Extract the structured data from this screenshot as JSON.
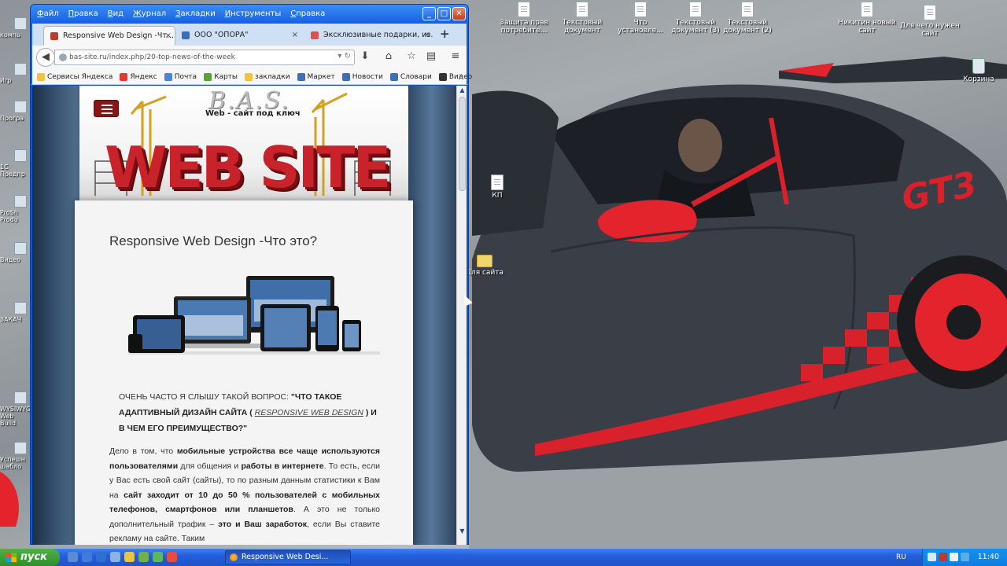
{
  "desktop": {
    "icons": [
      {
        "label": "Защита прав потребите...",
        "kind": "doc"
      },
      {
        "label": "Текстовый документ",
        "kind": "doc"
      },
      {
        "label": "Что установле...",
        "kind": "doc"
      },
      {
        "label": "Текстовый документ (3)",
        "kind": "doc"
      },
      {
        "label": "Текстовый документ (2)",
        "kind": "doc"
      },
      {
        "label": "Никитин новый сайт",
        "kind": "doc"
      },
      {
        "label": "Для чего нужен сайт",
        "kind": "doc"
      },
      {
        "label": "Корзина",
        "kind": "recycle-bin"
      },
      {
        "label": "КП",
        "kind": "doc"
      },
      {
        "label": "Для сайта",
        "kind": "folder"
      }
    ],
    "left_icons": [
      "компь",
      "Иrp",
      "Програ",
      "1С Предпр",
      "ProSh Produ",
      "Видео",
      "ЗАКАЧ",
      "WYSIWYG Web Build",
      "Успешн шабло"
    ]
  },
  "browser": {
    "menu": [
      "Файл",
      "Правка",
      "Вид",
      "Журнал",
      "Закладки",
      "Инструменты",
      "Справка"
    ],
    "window_buttons": {
      "minimize": "_",
      "maximize": "□",
      "close": "✕"
    },
    "tabs": [
      {
        "label": "Responsive Web Design -Чт...",
        "active": true,
        "icon_color": "#c0392b",
        "close": "×"
      },
      {
        "label": "ООО \"ОПОРА\"",
        "active": false,
        "icon_color": "#3a6fb7",
        "close": "×"
      },
      {
        "label": "Эксклюзивные подарки, из...",
        "active": false,
        "icon_color": "#d9534f",
        "close": "×"
      }
    ],
    "new_tab": "+",
    "url": "bas-site.ru/index.php/20-top-news-of-the-week",
    "bookmarks": [
      {
        "label": "Сервисы Яндекса",
        "color": "#f3c23c"
      },
      {
        "label": "Яндекс",
        "color": "#e33b2e"
      },
      {
        "label": "Почта",
        "color": "#4a86d8"
      },
      {
        "label": "Карты",
        "color": "#55a630"
      },
      {
        "label": "закладки",
        "color": "#f3c23c"
      },
      {
        "label": "Маркет",
        "color": "#3d6fb6"
      },
      {
        "label": "Новости",
        "color": "#3d6fb6"
      },
      {
        "label": "Словари",
        "color": "#3d6fb6"
      },
      {
        "label": "Видео",
        "color": "#333333"
      }
    ],
    "bookmarks_more": "»"
  },
  "page": {
    "brand": "B.A.S.",
    "tagline": "Web - сайт   под ключ",
    "big_word": "WEB SITE",
    "article_title": "Responsive Web Design -Что это?",
    "quote_lead": "ОЧЕНЬ ЧАСТО Я СЛЫШУ ТАКОЙ ВОПРОС: ",
    "quote_bold_1": "\"ЧТО ТАКОЕ АДАПТИВНЫЙ ДИЗАЙН САЙТА ( ",
    "quote_link": "RESPONSIVE WEB DESIGN",
    "quote_bold_2": " ) И В ЧЕМ ЕГО ПРЕИМУЩЕСТВО?\"",
    "p1": "Дело в том, что ",
    "p1_b1": "мобильные устройства все чаще используются пользователями",
    "p1_2": " для общения и ",
    "p1_b2": "работы в интернете",
    "p1_3": ". То есть, если у Вас есть свой сайт (сайты), то по разным данным статистики к Вам на ",
    "p1_b3": "сайт заходит от 10 до 50 % пользователей с мобильных телефонов, смартфонов или планшетов",
    "p1_4": ". А это не только дополнительный трафик – ",
    "p1_b4": "это и Ваш заработок",
    "p1_5": ", если Вы ставите рекламу на сайте. Таким"
  },
  "taskbar": {
    "start_label": "пуск",
    "task_item": "Responsive Web Desi...",
    "language": "RU",
    "clock": "11:40"
  },
  "colors": {
    "xp_blue": "#1560e0",
    "accent_red": "#c8222a",
    "car_body": "#3a3f47"
  }
}
